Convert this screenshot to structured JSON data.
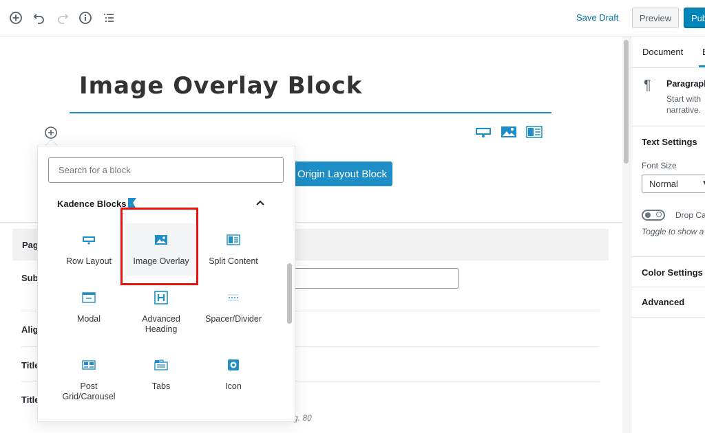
{
  "toolbar": {
    "save_draft": "Save Draft",
    "preview": "Preview",
    "publish": "Pub",
    "icons": [
      "add-block-icon",
      "undo-icon",
      "redo-icon",
      "info-icon",
      "outline-icon"
    ]
  },
  "editor": {
    "post_title": "Image Overlay Block",
    "origin_button": "Origin Layout Block",
    "meta": {
      "panel_label": "Pag",
      "rows": [
        "Sub",
        "Alig",
        "Title",
        "Title"
      ],
      "hint": "g. 80"
    }
  },
  "inserter": {
    "search_placeholder": "Search for a block",
    "panel_title": "Kadence Blocks",
    "blocks": [
      {
        "label": "Row Layout",
        "icon": "row-layout-icon"
      },
      {
        "label": "Image Overlay",
        "icon": "image-overlay-icon"
      },
      {
        "label": "Split Content",
        "icon": "split-content-icon"
      },
      {
        "label": "Modal",
        "icon": "modal-icon"
      },
      {
        "label": "Advanced Heading",
        "icon": "advanced-heading-icon"
      },
      {
        "label": "Spacer/Divider",
        "icon": "spacer-divider-icon"
      },
      {
        "label": "Post Grid/Carousel",
        "icon": "post-grid-icon"
      },
      {
        "label": "Tabs",
        "icon": "tabs-icon"
      },
      {
        "label": "Icon",
        "icon": "icon-block-icon"
      }
    ]
  },
  "sidebar": {
    "tab_document": "Document",
    "tab_block": "B",
    "block_name": "Paragraph",
    "block_desc_1": "Start with",
    "block_desc_2": "narrative.",
    "text_settings": "Text Settings",
    "font_size_label": "Font Size",
    "font_size_value": "Normal",
    "drop_cap_label": "Drop Ca",
    "drop_cap_help": "Toggle to show a",
    "color_settings": "Color Settings",
    "advanced": "Advanced"
  },
  "colors": {
    "accent": "#1d8ec6",
    "publish": "#0085ba",
    "highlight": "#e8120c"
  }
}
